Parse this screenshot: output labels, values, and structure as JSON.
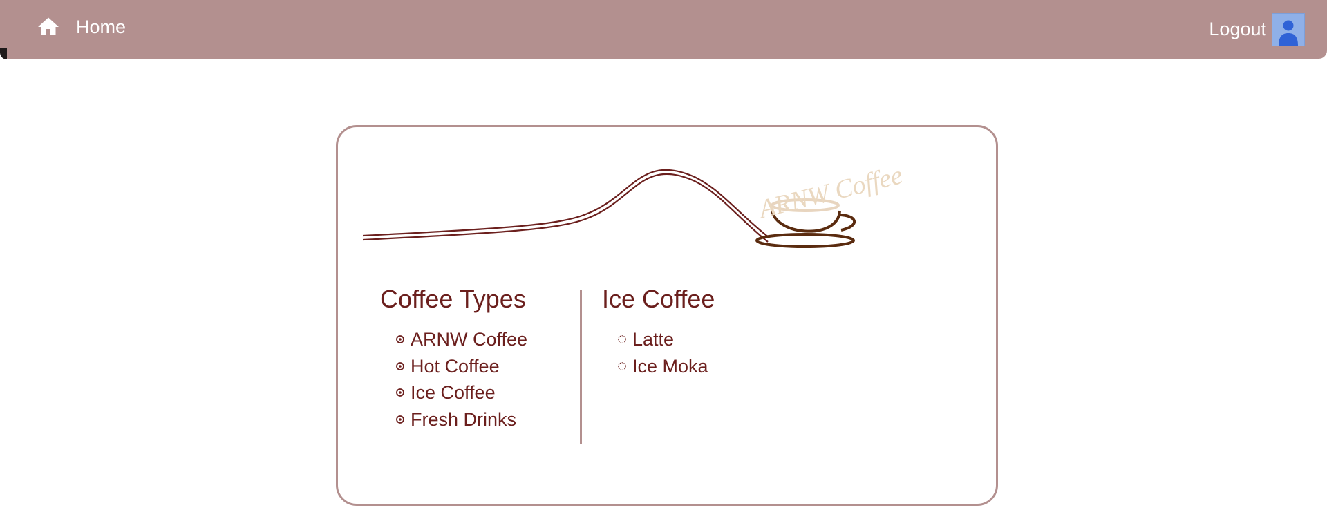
{
  "nav": {
    "home_label": "Home",
    "home_icon": "home-icon",
    "logout_label": "Logout",
    "avatar_icon": "user-avatar-icon",
    "bar_color": "#b3908f"
  },
  "logo": {
    "text": "ARNW Coffee"
  },
  "categories": {
    "title": "Coffee Types",
    "items": [
      "ARNW Coffee",
      "Hot Coffee",
      "Ice Coffee",
      "Fresh Drinks"
    ]
  },
  "selected": {
    "title": "Ice Coffee",
    "items": [
      "Latte",
      "Ice Moka"
    ]
  },
  "colors": {
    "accent": "#b3908f",
    "text": "#6b1f1d"
  }
}
